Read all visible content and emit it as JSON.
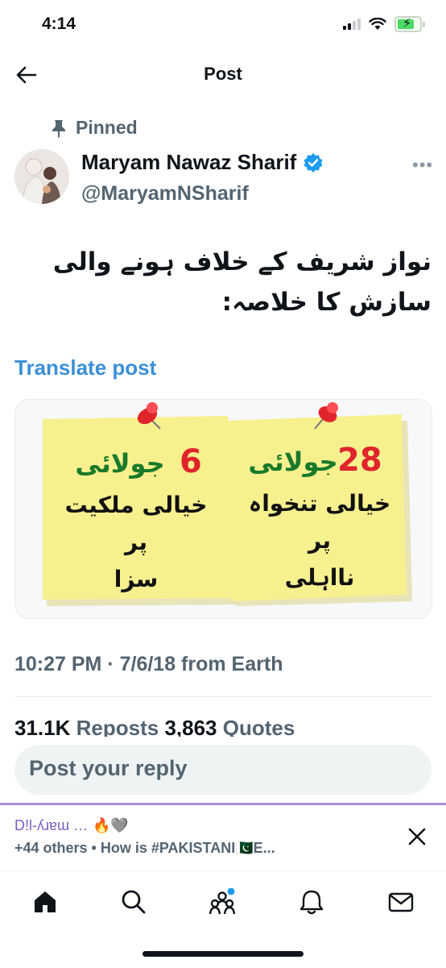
{
  "status_bar": {
    "time": "4:14"
  },
  "header": {
    "title": "Post"
  },
  "post": {
    "pinned_label": "Pinned",
    "author_name": "Maryam Nawaz Sharif",
    "author_handle": "@MaryamNSharif",
    "text": "نواز شریف کے خلاف ہونے والی سازش کا خلاصہ:",
    "translate_label": "Translate post",
    "image": {
      "left_note": {
        "number": "6",
        "month": "جولائی",
        "line2": "خیالی ملکیت",
        "line3": "پر",
        "line4": "سزا"
      },
      "right_note": {
        "number": "28",
        "month": "جولائی",
        "line2": "خیالی تنخواہ",
        "line3": "پر",
        "line4": "نااہلی"
      }
    },
    "timestamp": "10:27 PM · 7/6/18 from Earth",
    "reposts_count": "31.1K",
    "reposts_label": "Reposts",
    "quotes_count": "3,863",
    "quotes_label": "Quotes"
  },
  "reply": {
    "placeholder": "Post your reply"
  },
  "notification": {
    "line1_name": "D!l-ʎɹɐɯ …",
    "line1_emoji": "🔥🩶",
    "line2": "+44 others • How is #PAKISTANI🇵🇰E..."
  },
  "tabbar": {
    "items": [
      "home-icon",
      "search-icon",
      "communities-icon",
      "notifications-icon",
      "messages-icon"
    ]
  },
  "colors": {
    "accent": "#1d9bf0",
    "note_yellow": "#f7f08f",
    "pin_red": "#e0242b",
    "verified": "#1d9bf0"
  }
}
